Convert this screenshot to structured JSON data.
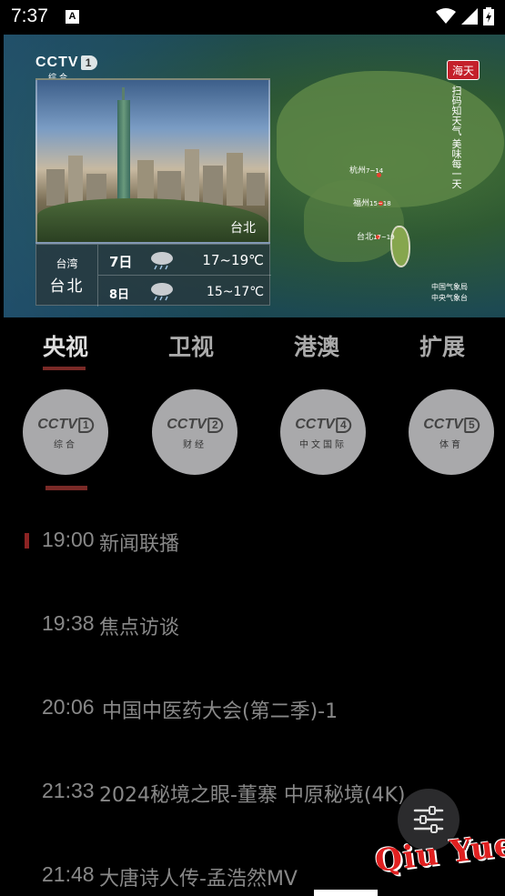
{
  "status_bar": {
    "time": "7:37",
    "notif_icon": "A"
  },
  "video": {
    "logo_text": "CCTV",
    "logo_channel": "1",
    "logo_sub": "综合",
    "photo_city": "台北",
    "weather": {
      "province": "台湾",
      "city": "台北",
      "rows": [
        {
          "day": "7日",
          "icon": "rain-cloud-icon",
          "temp": "17~19℃"
        },
        {
          "day": "8日",
          "icon": "rain-cloud-icon",
          "temp": "15~17℃"
        }
      ]
    },
    "brand": "海天",
    "brand_slogan": "扫码知天气 美味每一天",
    "map_cities": [
      {
        "name": "杭州",
        "temp": "7~14"
      },
      {
        "name": "福州",
        "temp": "15~18"
      },
      {
        "name": "台北",
        "temp": "17~19"
      }
    ],
    "credit_line1": "中国气象局",
    "credit_line2": "中央气象台"
  },
  "tabs": [
    {
      "label": "央视",
      "active": true
    },
    {
      "label": "卫视",
      "active": false
    },
    {
      "label": "港澳",
      "active": false
    },
    {
      "label": "扩展",
      "active": false
    }
  ],
  "channels": [
    {
      "logo": "CCTV",
      "num": "1",
      "sub": "综合"
    },
    {
      "logo": "CCTV",
      "num": "2",
      "sub": "财经"
    },
    {
      "logo": "CCTV",
      "num": "4",
      "sub": "中文国际"
    },
    {
      "logo": "CCTV",
      "num": "5",
      "sub": "体育"
    }
  ],
  "programs": [
    {
      "time": "19:00",
      "title": "新闻联播",
      "current": true
    },
    {
      "time": "19:38",
      "title": "焦点访谈",
      "current": false
    },
    {
      "time": "20:06",
      "title": "中国中医药大会(第二季)-1",
      "current": false
    },
    {
      "time": "21:33",
      "title": "2024秘境之眼-董寨 中原秘境(4K)",
      "current": false
    },
    {
      "time": "21:48",
      "title": "大唐诗人传-孟浩然MV",
      "current": false
    }
  ],
  "fab": {
    "icon": "sliders-icon"
  },
  "watermark": "Qiu Yue",
  "colors": {
    "accent": "#7a2a27",
    "background": "#000000",
    "text": "#888888"
  }
}
